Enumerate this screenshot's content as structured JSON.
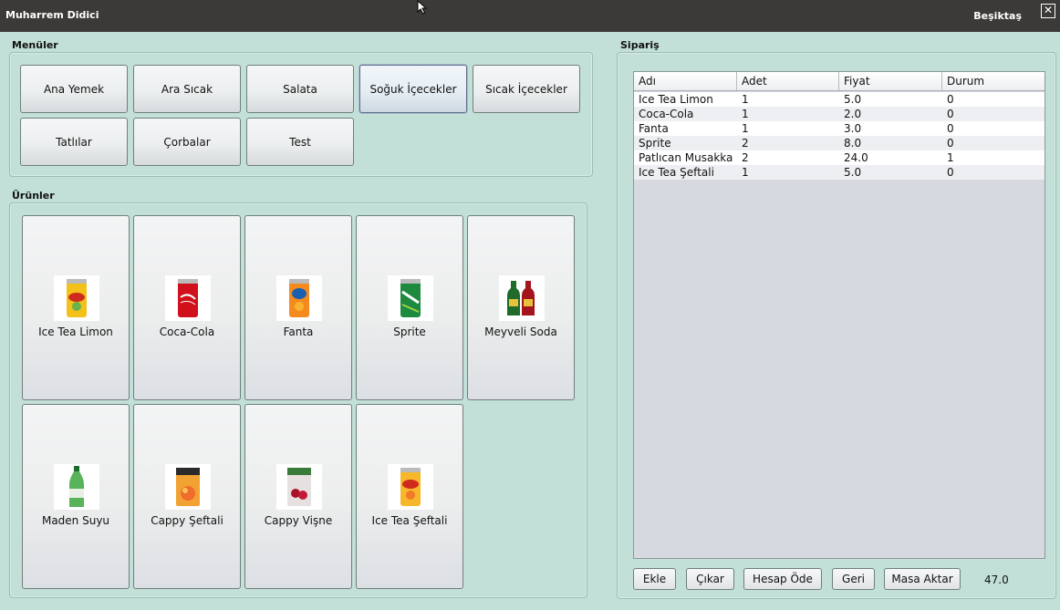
{
  "titlebar": {
    "user": "Muharrem Didici",
    "place": "Beşiktaş",
    "close_glyph": "✕"
  },
  "menus": {
    "label": "Menüler",
    "items": [
      {
        "label": "Ana Yemek"
      },
      {
        "label": "Ara Sıcak"
      },
      {
        "label": "Salata"
      },
      {
        "label": "Soğuk İçecekler",
        "selected": true
      },
      {
        "label": "Sıcak İçecekler"
      },
      {
        "label": "Tatlılar"
      },
      {
        "label": "Çorbalar"
      },
      {
        "label": "Test"
      }
    ]
  },
  "products": {
    "label": "Ürünler",
    "items": [
      {
        "label": "Ice Tea Limon",
        "icon": "ice-tea-lemon-can-icon"
      },
      {
        "label": "Coca-Cola",
        "icon": "coca-cola-can-icon"
      },
      {
        "label": "Fanta",
        "icon": "fanta-can-icon"
      },
      {
        "label": "Sprite",
        "icon": "sprite-can-icon"
      },
      {
        "label": "Meyveli Soda",
        "icon": "fruit-soda-bottles-icon"
      },
      {
        "label": "Maden Suyu",
        "icon": "mineral-water-bottle-icon"
      },
      {
        "label": "Cappy Şeftali",
        "icon": "cappy-peach-icon"
      },
      {
        "label": "Cappy Vişne",
        "icon": "cappy-cherry-icon"
      },
      {
        "label": "Ice Tea Şeftali",
        "icon": "ice-tea-peach-can-icon"
      }
    ]
  },
  "order": {
    "label": "Sipariş",
    "columns": [
      "Adı",
      "Adet",
      "Fiyat",
      "Durum"
    ],
    "rows": [
      [
        "Ice Tea Limon",
        "1",
        "5.0",
        "0"
      ],
      [
        "Coca-Cola",
        "1",
        "2.0",
        "0"
      ],
      [
        "Fanta",
        "1",
        "3.0",
        "0"
      ],
      [
        "Sprite",
        "2",
        "8.0",
        "0"
      ],
      [
        "Patlıcan Musakka",
        "2",
        "24.0",
        "1"
      ],
      [
        "Ice Tea Şeftali",
        "1",
        "5.0",
        "0"
      ]
    ],
    "buttons": {
      "add": "Ekle",
      "remove": "Çıkar",
      "pay": "Hesap Öde",
      "back": "Geri",
      "transfer": "Masa Aktar"
    },
    "total": "47.0"
  },
  "colors": {
    "background": "#c2e0d8",
    "titlebar": "#3c3a38",
    "table_bg": "#d6d9df"
  }
}
